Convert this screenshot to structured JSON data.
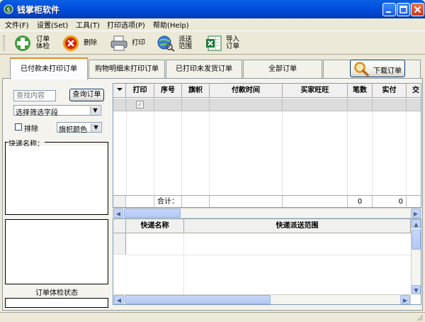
{
  "window": {
    "title": "钱掌柜软件"
  },
  "menu": [
    "文件(F)",
    "设置(Set)",
    "工具(T)",
    "打印选项(P)",
    "帮助(Help)"
  ],
  "toolbar": {
    "check_line1": "订单",
    "check_line2": "体检",
    "delete": "删除",
    "print": "打印",
    "ship_line1": "派送",
    "ship_line2": "范围",
    "import_line1": "导入",
    "import_line2": "订单"
  },
  "tabs": [
    "已付款未打印订单",
    "购物明细未打印订单",
    "已打印未发货订单",
    "全部订单"
  ],
  "download_button": "下载订单",
  "left": {
    "search_placeholder": "查找内容",
    "search_button": "查询订单",
    "filter_select": "选择筛选字段",
    "exclude_label": "排除",
    "flag_select": "旗帜颜色",
    "courier_group": "快递名称：",
    "check_status": "订单体检状态"
  },
  "grid": {
    "columns": [
      "打印",
      "序号",
      "旗帜",
      "付款时间",
      "买家旺旺",
      "笔数",
      "实付",
      "交"
    ],
    "sum_label": "合计：",
    "sum_count": "0",
    "sum_paid": "0"
  },
  "grid2": {
    "columns": [
      "快递名称",
      "快递派送范围"
    ]
  },
  "colors": {
    "titlebar": "#0054E3",
    "active_tab_accent": "#E68B2C"
  }
}
